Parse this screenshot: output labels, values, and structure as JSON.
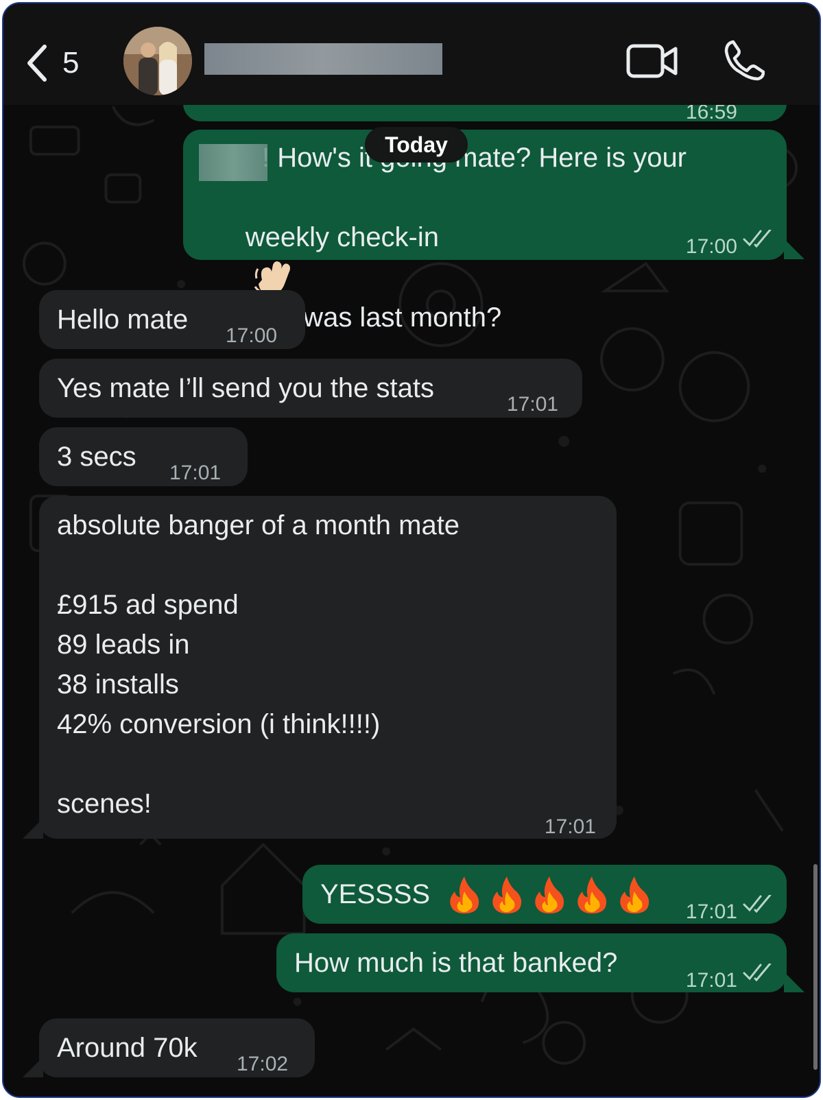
{
  "header": {
    "back_count": "5",
    "contact_name": "",
    "icons": {
      "back": "chevron-left-icon",
      "video": "video-camera-icon",
      "call": "phone-icon"
    }
  },
  "date_divider": "Today",
  "top_cut_time": "16:59",
  "messages": [
    {
      "direction": "outgoing",
      "line1": "! How's it going mate? Here is your",
      "line2_a": "weekly check-in",
      "line2_emoji": "waving-hand-emoji",
      "line2_b": "how was last month?",
      "time": "17:00",
      "status": "read"
    },
    {
      "direction": "incoming",
      "text": "Hello mate",
      "time": "17:00"
    },
    {
      "direction": "incoming",
      "text": "Yes mate I’ll send you the stats",
      "time": "17:01"
    },
    {
      "direction": "incoming",
      "text": "3 secs",
      "time": "17:01"
    },
    {
      "direction": "incoming",
      "lines": [
        "absolute banger of a month mate",
        "",
        "£915 ad spend",
        "89 leads in",
        "38 installs",
        "42% conversion (i think!!!!)",
        "",
        "scenes!"
      ],
      "time": "17:01"
    },
    {
      "direction": "outgoing",
      "text": "YESSSS",
      "emoji": "fire-emoji",
      "emoji_count": 5,
      "time": "17:01",
      "status": "read"
    },
    {
      "direction": "outgoing",
      "text": "How much is that banked?",
      "time": "17:01",
      "status": "read"
    },
    {
      "direction": "incoming",
      "text": "Around 70k",
      "time": "17:02"
    }
  ],
  "colors": {
    "background": "#0b0b0b",
    "header": "#121212",
    "incoming_bubble": "#202223",
    "outgoing_bubble": "#0e5a3b",
    "text": "#e9edef",
    "frame_border": "#1e3a8a"
  }
}
